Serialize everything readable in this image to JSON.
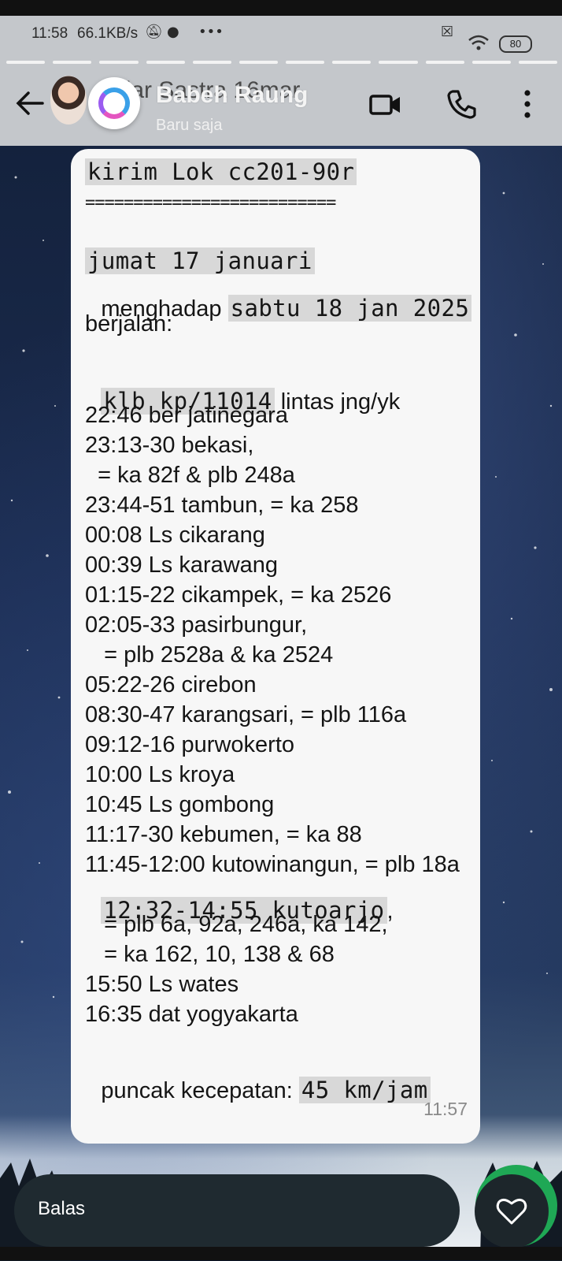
{
  "status_bar": {
    "time": "11:58",
    "network_rate": "66.1KB/s",
    "battery": "80"
  },
  "header": {
    "underlying_name": "Diar Sastra 16mar",
    "name": "Babeh Raung",
    "subtitle": "Baru saja"
  },
  "message": {
    "lines": [
      {
        "text": "kirim Lok cc201-90r",
        "style": "mono-hl"
      },
      {
        "text": "==========================",
        "style": "eq"
      },
      {
        "text": "jumat 17 januari",
        "style": "mono-hl"
      },
      {
        "text_pre": "menghadap ",
        "text_hl": "sabtu 18 jan 2025",
        "style": "mixed"
      },
      {
        "text": "berjalan:",
        "style": "norm"
      },
      {
        "text_hl": "klb kp/11014",
        "text_post": " lintas jng/yk",
        "style": "mixed2"
      },
      {
        "text": "22:46 ber jatinegara",
        "style": "norm"
      },
      {
        "text": "23:13-30 bekasi,",
        "style": "norm"
      },
      {
        "text": "  = ka 82f & plb 248a",
        "style": "norm"
      },
      {
        "text": "23:44-51 tambun, = ka 258",
        "style": "norm"
      },
      {
        "text": "00:08 Ls cikarang",
        "style": "norm"
      },
      {
        "text": "00:39 Ls karawang",
        "style": "norm"
      },
      {
        "text": "01:15-22 cikampek, = ka 2526",
        "style": "norm"
      },
      {
        "text": "02:05-33 pasirbungur,",
        "style": "norm"
      },
      {
        "text": "   = plb 2528a & ka 2524",
        "style": "norm"
      },
      {
        "text": "05:22-26 cirebon",
        "style": "norm"
      },
      {
        "text": "08:30-47 karangsari, = plb 116a",
        "style": "norm"
      },
      {
        "text": "09:12-16 purwokerto",
        "style": "norm"
      },
      {
        "text": "10:00 Ls kroya",
        "style": "norm"
      },
      {
        "text": "10:45 Ls gombong",
        "style": "norm"
      },
      {
        "text": "11:17-30 kebumen, = ka 88",
        "style": "norm"
      },
      {
        "text": "11:45-12:00 kutowinangun, = plb 18a",
        "style": "norm"
      },
      {
        "text_hl": "12:32-14:55 kutoarjo",
        "text_post": ",",
        "style": "mixed2"
      },
      {
        "text": "   = plb 6a, 92a, 246a, ka 142,",
        "style": "norm"
      },
      {
        "text": "   = ka 162, 10, 138 & 68",
        "style": "norm"
      },
      {
        "text": "15:50 Ls wates",
        "style": "norm"
      },
      {
        "text": "16:35 dat yogyakarta",
        "style": "norm"
      },
      {
        "text_pre": "puncak kecepatan: ",
        "text_hl": "45 km/jam",
        "style": "mixed"
      }
    ],
    "timestamp": "11:57"
  },
  "reply_bar": {
    "placeholder": "Balas"
  },
  "colors": {
    "header_bg": "#c4c7cb",
    "bubble_bg": "#f7f7f7",
    "highlight": "#d8d8d8",
    "reply_bg": "#1f2a30",
    "accent_green": "#1fa855"
  },
  "icons": [
    "back-arrow-icon",
    "video-call-icon",
    "phone-icon",
    "more-vertical-icon",
    "heart-icon",
    "wifi-icon",
    "mute-bell-icon"
  ]
}
